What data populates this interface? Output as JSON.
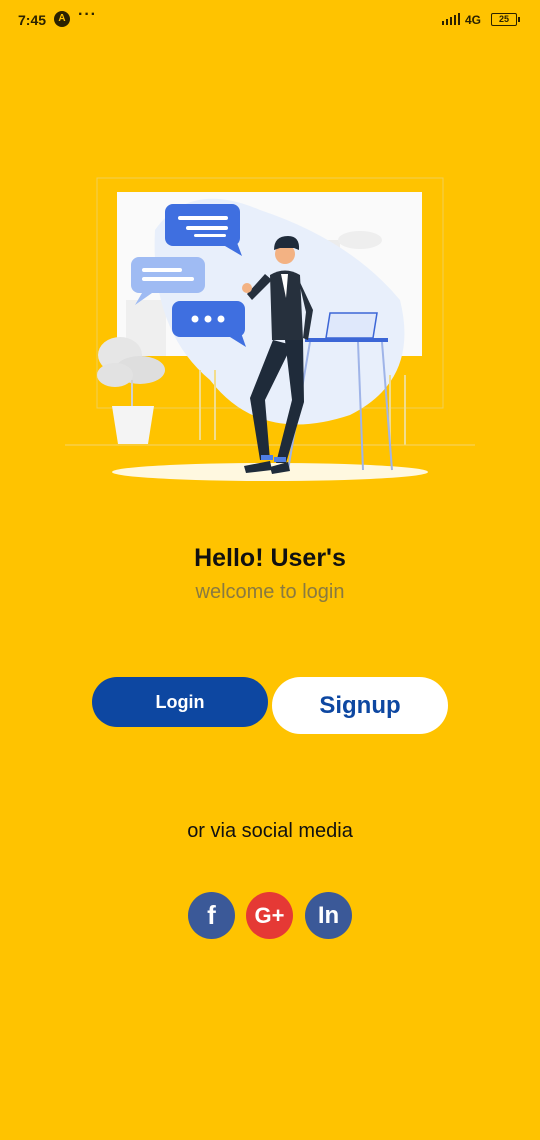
{
  "status_bar": {
    "time": "7:45",
    "notification_letter": "A",
    "overflow": "···",
    "network": "4G",
    "battery": "25"
  },
  "welcome": {
    "title": "Hello! User's",
    "subtitle": "welcome to login"
  },
  "buttons": {
    "login_label": "Login",
    "signup_label": "Signup"
  },
  "social": {
    "label": "or via social media",
    "facebook_glyph": "f",
    "google_glyph": "G+",
    "linkedin_glyph": "In"
  },
  "colors": {
    "background": "#FFC300",
    "primary": "#0D47A1",
    "facebook": "#3B5998",
    "google": "#E53935"
  }
}
